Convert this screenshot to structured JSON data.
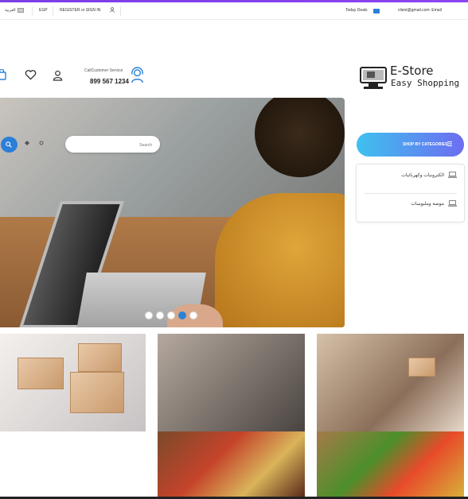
{
  "topbar": {
    "language": "العربية",
    "currency": "EGP",
    "register": "REGISTER",
    "or": "or",
    "signin": "SIGN IN",
    "today_deals": "Today Deals",
    "email": "client@gmail.com: Email"
  },
  "header": {
    "customer_service_label": "CallCustomer Service",
    "phone": "899 567 1234",
    "logo_title": "E-Store",
    "logo_subtitle": "Easy Shopping"
  },
  "search": {
    "placeholder": "Search"
  },
  "categories": {
    "button_label": "SHOP BY CATEGORIES",
    "items": [
      {
        "label": "الكترونيات وكهربائيات",
        "icon": "laptop-icon"
      },
      {
        "label": "موضة وملبوسات",
        "icon": "laptop-icon"
      }
    ]
  },
  "slider": {
    "dot_count": 5,
    "active_index": 3
  },
  "colors": {
    "accent_blue": "#2c82d6",
    "top_stripe": "#7b3fe4",
    "category_gradient_start": "#3ec1ef",
    "category_gradient_end": "#6d6df0"
  }
}
